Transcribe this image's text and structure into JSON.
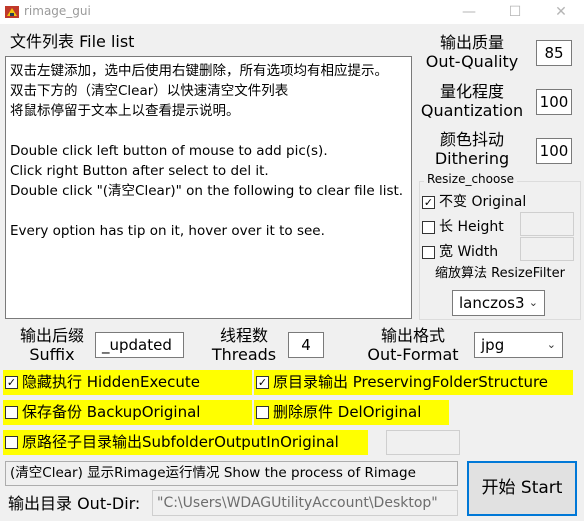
{
  "window": {
    "title": "rimage_gui",
    "minimize_glyph": "—",
    "maximize_glyph": "☐",
    "close_glyph": "✕",
    "icon": "rimage-app-icon"
  },
  "file_list": {
    "label": "文件列表 File list",
    "content": "双击左键添加，选中后使用右键删除，所有选项均有相应提示。\n双击下方的（清空Clear）以快速清空文件列表\n将鼠标停留于文本上以查看提示说明。\n\nDouble click left button of mouse to add pic(s).\nClick right Button after select to del it.\nDouble click \"(清空Clear)\" on the following to clear file list.\n\nEvery option has tip on it, hover over it to see."
  },
  "quality": {
    "label_cn": "输出质量",
    "label_en": "Out-Quality",
    "value": "85"
  },
  "quantization": {
    "label_cn": "量化程度",
    "label_en": "Quantization",
    "value": "100"
  },
  "dithering": {
    "label_cn": "颜色抖动",
    "label_en": "Dithering",
    "value": "100"
  },
  "resize": {
    "group_title": "Resize_choose",
    "original_label": "不变 Original",
    "original_checked": true,
    "height_label": "长 Height",
    "height_checked": false,
    "width_label": "宽 Width",
    "width_checked": false,
    "filter_label": "缩放算法 ResizeFilter",
    "filter_value": "lanczos3"
  },
  "suffix": {
    "label_cn": "输出后缀",
    "label_en": "Suffix",
    "value": "_updated"
  },
  "threads": {
    "label_cn": "线程数",
    "label_en": "Threads",
    "value": "4"
  },
  "format": {
    "label_cn": "输出格式",
    "label_en": "Out-Format",
    "value": "jpg"
  },
  "options": {
    "hidden_execute": {
      "label": "隐藏执行 HiddenExecute",
      "checked": true
    },
    "preserving": {
      "label": "原目录输出 PreservingFolderStructure",
      "checked": true
    },
    "backup": {
      "label": "保存备份 BackupOriginal",
      "checked": false
    },
    "del_original": {
      "label": "删除原件 DelOriginal",
      "checked": false
    },
    "subfolder": {
      "label": "原路径子目录输出SubfolderOutputInOriginal",
      "checked": false
    }
  },
  "status": {
    "text": "(清空Clear) 显示Rimage运行情况 Show the process of Rimage"
  },
  "start_button": {
    "label": "开始 Start"
  },
  "outdir": {
    "label": "输出目录 Out-Dir:",
    "value": "\"C:\\Users\\WDAGUtilityAccount\\Desktop\""
  },
  "colors": {
    "highlight": "#ffff00",
    "start_border": "#0078d7",
    "check_mark": "☑"
  }
}
